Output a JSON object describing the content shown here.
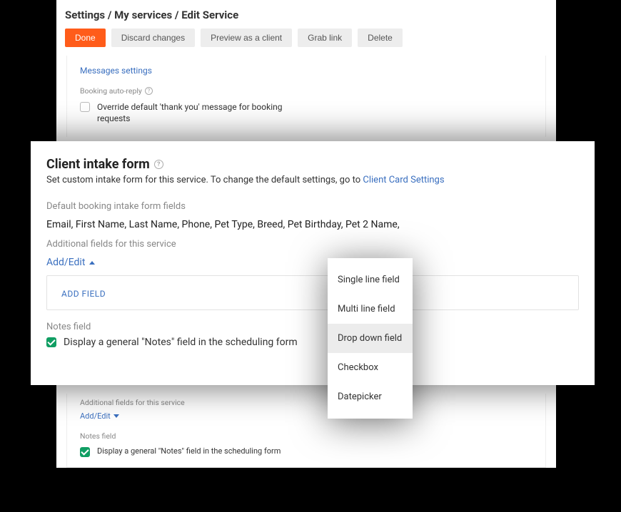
{
  "breadcrumb": "Settings / My services / Edit Service",
  "buttons": {
    "done": "Done",
    "discard": "Discard changes",
    "preview": "Preview as a client",
    "grab": "Grab link",
    "delete": "Delete"
  },
  "back": {
    "messages_link": "Messages settings",
    "booking_auto_reply_label": "Booking auto-reply",
    "override_text": "Override default 'thank you' message for booking requests",
    "additional_fields_label": "Additional fields for this service",
    "add_edit": "Add/Edit",
    "notes_field_label": "Notes field",
    "notes_checkbox_text": "Display a general \"Notes\" field in the scheduling form"
  },
  "front": {
    "title": "Client intake form",
    "subtitle_prefix": "Set custom intake form for this service. To change the default settings, go to ",
    "subtitle_link": "Client Card Settings",
    "default_fields_label": "Default booking intake form fields",
    "default_fields": "Email, First Name, Last Name, Phone, Pet Type, Breed, Pet Birthday, Pet 2 Name,",
    "additional_fields_label": "Additional fields for this service",
    "add_edit": "Add/Edit",
    "add_field": "ADD FIELD",
    "notes_field_label": "Notes field",
    "notes_checkbox_text": "Display a general \"Notes\" field in the scheduling form"
  },
  "dropdown": {
    "items": [
      "Single line field",
      "Multi line field",
      "Drop down field",
      "Checkbox",
      "Datepicker"
    ],
    "hover_index": 2
  }
}
